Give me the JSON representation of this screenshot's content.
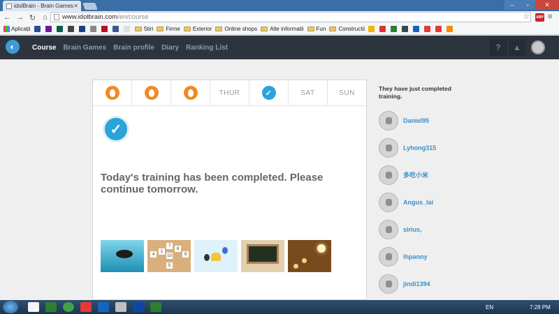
{
  "browser": {
    "tab_title": "idolBrain - Brain Games &",
    "url_host": "www.idolbrain.com",
    "url_path": "/en/course",
    "abp_label": "ABP"
  },
  "bookmarks": {
    "items": [
      "Aplicații",
      "Stiri",
      "Firme",
      "Exterior",
      "Online shops",
      "Alte informatii",
      "Fun",
      "Constructii"
    ]
  },
  "site_nav": {
    "links": [
      "Course",
      "Brain Games",
      "Brain profile",
      "Diary",
      "Ranking List"
    ],
    "active": "Course",
    "help_glyph": "?"
  },
  "week": {
    "days": [
      {
        "label": "",
        "state": "done"
      },
      {
        "label": "",
        "state": "done"
      },
      {
        "label": "",
        "state": "done"
      },
      {
        "label": "THUR",
        "state": "empty"
      },
      {
        "label": "",
        "state": "today"
      },
      {
        "label": "SAT",
        "state": "empty"
      },
      {
        "label": "SUN",
        "state": "empty"
      }
    ]
  },
  "main": {
    "completed_message": "Today's training has been completed. Please continue tomorrow."
  },
  "sidebar": {
    "title": "They have just completed training.",
    "users": [
      "Daniel95",
      "Lyhong315",
      "多吃小米",
      "Angus_lai",
      "sirius,",
      "lhpanny",
      "jindi1394"
    ]
  },
  "taskbar": {
    "language": "EN",
    "time": "7:28 PM"
  },
  "colors": {
    "nav_bg": "#2d343e",
    "accent_blue": "#2aa3d9",
    "flame_orange": "#f08a24",
    "username_blue": "#3a8fc8"
  }
}
